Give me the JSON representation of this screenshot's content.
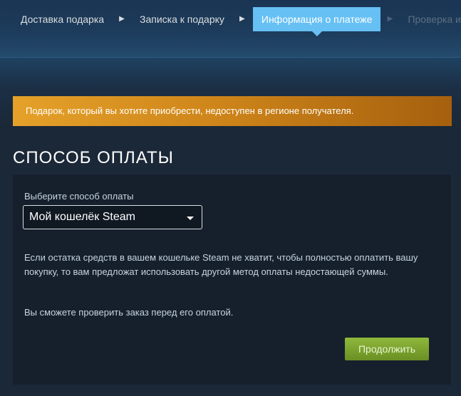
{
  "breadcrumb": {
    "steps": [
      {
        "label": "Доставка подарка"
      },
      {
        "label": "Записка к подарку"
      },
      {
        "label": "Информация о платеже"
      },
      {
        "label": "Проверка и пок"
      }
    ],
    "separator": "▶"
  },
  "notice": {
    "text": "Подарок, который вы хотите приобрести, недоступен в регионе получателя."
  },
  "section": {
    "title": "СПОСОБ ОПЛАТЫ"
  },
  "payment": {
    "select_label": "Выберите способ оплаты",
    "selected": "Мой кошелёк Steam",
    "note_wallet": "Если остатка средств в вашем кошельке Steam не хватит, чтобы полностью оплатить вашу покупку, то вам предложат использовать другой метод оплаты недостающей суммы.",
    "note_review": "Вы сможете проверить заказ перед его оплатой.",
    "continue_label": "Продолжить"
  },
  "colors": {
    "accent_blue": "#66c0f4",
    "notice_orange": "#e5a12a",
    "button_green": "#8fb93b",
    "background": "#1b2838"
  },
  "icons": {
    "step_separator": "triangle-right-icon",
    "dropdown": "chevron-down-icon"
  }
}
